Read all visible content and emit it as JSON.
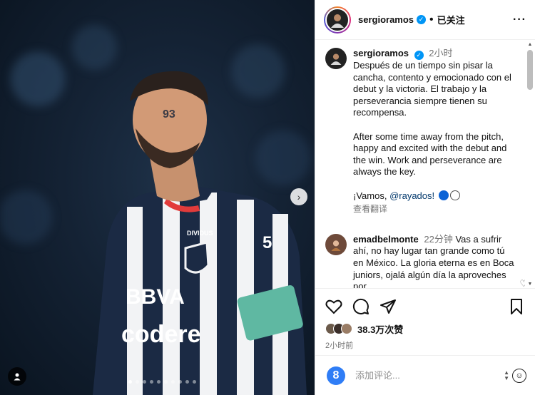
{
  "colors": {
    "verified": "#0095f6",
    "link": "#00376b",
    "meta_gray": "#737373",
    "jersey_navy": "#1b2a44",
    "jersey_white": "#f2f3f5"
  },
  "media": {
    "jersey_sponsor_top": "BBVA",
    "jersey_sponsor_bottom": "codere",
    "jersey_brand": "DIVIDUS",
    "jersey_number": "93",
    "sleeve_number": "5",
    "next_icon": "chevron-right-icon",
    "tag_icon": "user-tag-icon",
    "dots_total": 10,
    "dots_active": 0
  },
  "header": {
    "username": "sergioramos",
    "follow_status": "已关注",
    "verified_icon": "verified-badge-icon",
    "more_icon": "more-horizontal-icon"
  },
  "caption": {
    "username": "sergioramos",
    "time": "2小时",
    "paragraph_es": "Después de un tiempo sin pisar la cancha, contento y emocionado con el debut y la victoria. El trabajo y la perseverancia siempre tienen su recompensa.",
    "paragraph_en": "After some time away from the pitch, happy and excited with the debut and the win. Work and perseverance are always the key.",
    "closing_prefix": "¡Vamos, ",
    "mention": "@rayados!",
    "translate": "查看翻译"
  },
  "comment": {
    "username": "emadbelmonte",
    "time": "22分钟",
    "text": "Vas a sufrir ahí, no hay lugar tan grande como tú en México. La gloria eterna es en Boca juniors, ojalá algún día la aproveches por"
  },
  "actions": {
    "like_icon": "heart-icon",
    "comment_icon": "comment-icon",
    "share_icon": "send-icon",
    "save_icon": "bookmark-icon",
    "likes": "38.3万次赞",
    "post_time": "2小时前"
  },
  "add_comment": {
    "placeholder": "添加评论...",
    "logo_text": "8",
    "emoji_icon": "smiley-icon"
  }
}
